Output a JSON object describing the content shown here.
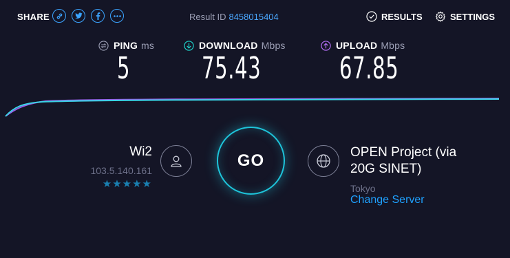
{
  "topbar": {
    "share_label": "SHARE",
    "share_icons": [
      "link-icon",
      "twitter-icon",
      "facebook-icon",
      "more-icon"
    ],
    "result_label": "Result ID",
    "result_id": "8458015404",
    "results_label": "RESULTS",
    "settings_label": "SETTINGS"
  },
  "metrics": {
    "ping": {
      "label": "PING",
      "unit": "ms",
      "value": "5"
    },
    "download": {
      "label": "DOWNLOAD",
      "unit": "Mbps",
      "value": "75.43",
      "color": "#1ed1c8"
    },
    "upload": {
      "label": "UPLOAD",
      "unit": "Mbps",
      "value": "67.85",
      "color": "#b06df2"
    }
  },
  "go_label": "GO",
  "isp": {
    "name": "Wi2",
    "ip": "103.5.140.161",
    "stars": "★★★★★",
    "rating": 5
  },
  "server": {
    "name": "OPEN Project (via 20G SINET)",
    "city": "Tokyo",
    "change_label": "Change Server"
  }
}
